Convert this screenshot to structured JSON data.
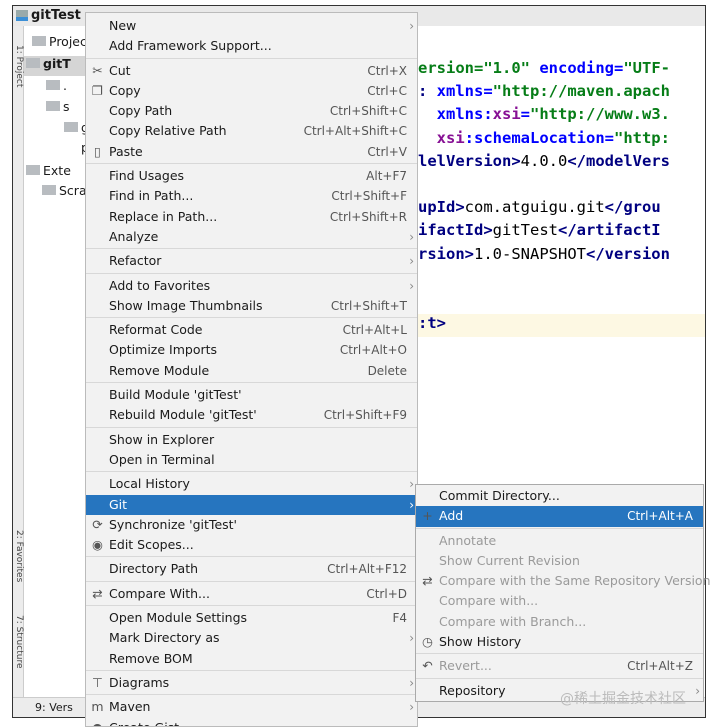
{
  "window": {
    "title": "gitTest"
  },
  "tool_strip": {
    "project": "1: Project",
    "favorites": "2: Favorites",
    "structure": "7: Structure"
  },
  "project_tree": [
    {
      "label": "Projec",
      "icon": "project-icon"
    },
    {
      "label": "gitT",
      "icon": "module-folder-icon"
    },
    {
      "label": ".",
      "icon": "folder-icon"
    },
    {
      "label": "s",
      "icon": "folder-icon"
    },
    {
      "label": "g",
      "icon": "file-icon"
    },
    {
      "label": "p",
      "icon": "maven-icon"
    },
    {
      "label": "Exte",
      "icon": "libraries-icon"
    },
    {
      "label": "Scra",
      "icon": "scratches-icon"
    }
  ],
  "bottom_bar": {
    "version_control": "9: Vers"
  },
  "editor": {
    "lines": [
      [
        [
          "val",
          "ersion=\"1.0\""
        ],
        [
          "txt",
          " "
        ],
        [
          "attr",
          "encoding="
        ],
        [
          "val",
          "\"UTF-"
        ]
      ],
      [
        [
          "tag",
          ": "
        ],
        [
          "attr",
          "xmlns="
        ],
        [
          "val",
          "\"http://maven.apach"
        ]
      ],
      [
        [
          "attr",
          "  xmlns:"
        ],
        [
          "ns",
          "xsi"
        ],
        [
          "attr",
          "="
        ],
        [
          "val",
          "\"http://www.w3."
        ]
      ],
      [
        [
          "ns",
          "  xsi"
        ],
        [
          "attr",
          ":schemaLocation="
        ],
        [
          "val",
          "\"http:"
        ]
      ],
      [
        [
          "tag",
          "lelVersion>"
        ],
        [
          "txt",
          "4.0.0"
        ],
        [
          "tag",
          "</modelVers"
        ]
      ],
      [],
      [
        [
          "tag",
          "upId>"
        ],
        [
          "txt",
          "com.atguigu.git"
        ],
        [
          "tag",
          "</grou"
        ]
      ],
      [
        [
          "tag",
          "ifactId>"
        ],
        [
          "txt",
          "gitTest"
        ],
        [
          "tag",
          "</artifactI"
        ]
      ],
      [
        [
          "tag",
          "rsion>"
        ],
        [
          "txt",
          "1.0-SNAPSHOT"
        ],
        [
          "tag",
          "</version"
        ]
      ],
      [],
      [],
      [
        [
          "tag",
          ":t>"
        ]
      ]
    ]
  },
  "context_menu": [
    {
      "label": "New",
      "arrow": true
    },
    {
      "label": "Add Framework Support..."
    },
    {
      "sep": true
    },
    {
      "label": "Cut",
      "shortcut": "Ctrl+X",
      "icon": "scissors-icon",
      "glyph": "✂"
    },
    {
      "label": "Copy",
      "shortcut": "Ctrl+C",
      "icon": "copy-icon",
      "glyph": "❐"
    },
    {
      "label": "Copy Path",
      "shortcut": "Ctrl+Shift+C"
    },
    {
      "label": "Copy Relative Path",
      "shortcut": "Ctrl+Alt+Shift+C"
    },
    {
      "label": "Paste",
      "shortcut": "Ctrl+V",
      "icon": "clipboard-icon",
      "glyph": "▯"
    },
    {
      "sep": true
    },
    {
      "label": "Find Usages",
      "shortcut": "Alt+F7"
    },
    {
      "label": "Find in Path...",
      "shortcut": "Ctrl+Shift+F"
    },
    {
      "label": "Replace in Path...",
      "shortcut": "Ctrl+Shift+R"
    },
    {
      "label": "Analyze",
      "arrow": true
    },
    {
      "sep": true
    },
    {
      "label": "Refactor",
      "arrow": true
    },
    {
      "sep": true
    },
    {
      "label": "Add to Favorites",
      "arrow": true
    },
    {
      "label": "Show Image Thumbnails",
      "shortcut": "Ctrl+Shift+T"
    },
    {
      "sep": true
    },
    {
      "label": "Reformat Code",
      "shortcut": "Ctrl+Alt+L"
    },
    {
      "label": "Optimize Imports",
      "shortcut": "Ctrl+Alt+O"
    },
    {
      "label": "Remove Module",
      "shortcut": "Delete"
    },
    {
      "sep": true
    },
    {
      "label": "Build Module 'gitTest'"
    },
    {
      "label": "Rebuild Module 'gitTest'",
      "shortcut": "Ctrl+Shift+F9"
    },
    {
      "sep": true
    },
    {
      "label": "Show in Explorer"
    },
    {
      "label": "Open in Terminal"
    },
    {
      "sep": true
    },
    {
      "label": "Local History",
      "arrow": true
    },
    {
      "label": "Git",
      "arrow": true,
      "selected": true
    },
    {
      "label": "Synchronize 'gitTest'",
      "icon": "sync-icon",
      "glyph": "⟳"
    },
    {
      "label": "Edit Scopes...",
      "icon": "scope-icon",
      "glyph": "◉"
    },
    {
      "sep": true
    },
    {
      "label": "Directory Path",
      "shortcut": "Ctrl+Alt+F12"
    },
    {
      "sep": true
    },
    {
      "label": "Compare With...",
      "shortcut": "Ctrl+D",
      "icon": "compare-icon",
      "glyph": "⇄"
    },
    {
      "sep": true
    },
    {
      "label": "Open Module Settings",
      "shortcut": "F4"
    },
    {
      "label": "Mark Directory as",
      "arrow": true
    },
    {
      "label": "Remove BOM"
    },
    {
      "sep": true
    },
    {
      "label": "Diagrams",
      "arrow": true,
      "icon": "diagram-icon",
      "glyph": "⊤"
    },
    {
      "sep": true
    },
    {
      "label": "Maven",
      "arrow": true,
      "icon": "maven-icon",
      "glyph": "m"
    },
    {
      "label": "Create Gist...",
      "icon": "github-icon",
      "glyph": "●"
    }
  ],
  "git_submenu": [
    {
      "label": "Commit Directory..."
    },
    {
      "label": "Add",
      "shortcut": "Ctrl+Alt+A",
      "selected": true,
      "icon": "plus-icon",
      "glyph": "+"
    },
    {
      "sep": true
    },
    {
      "label": "Annotate",
      "disabled": true
    },
    {
      "label": "Show Current Revision",
      "disabled": true
    },
    {
      "label": "Compare with the Same Repository Version",
      "disabled": true,
      "icon": "compare-icon",
      "glyph": "⇄"
    },
    {
      "label": "Compare with...",
      "disabled": true
    },
    {
      "label": "Compare with Branch...",
      "disabled": true
    },
    {
      "label": "Show History",
      "icon": "clock-icon",
      "glyph": "◷"
    },
    {
      "sep": true
    },
    {
      "label": "Revert...",
      "shortcut": "Ctrl+Alt+Z",
      "disabled": true,
      "icon": "revert-icon",
      "glyph": "↶"
    },
    {
      "sep": true
    },
    {
      "label": "Repository",
      "arrow": true
    }
  ],
  "watermark": "@稀土掘金技术社区",
  "colors": {
    "selection": "#2675bf",
    "menu_bg": "#f2f2f2"
  }
}
